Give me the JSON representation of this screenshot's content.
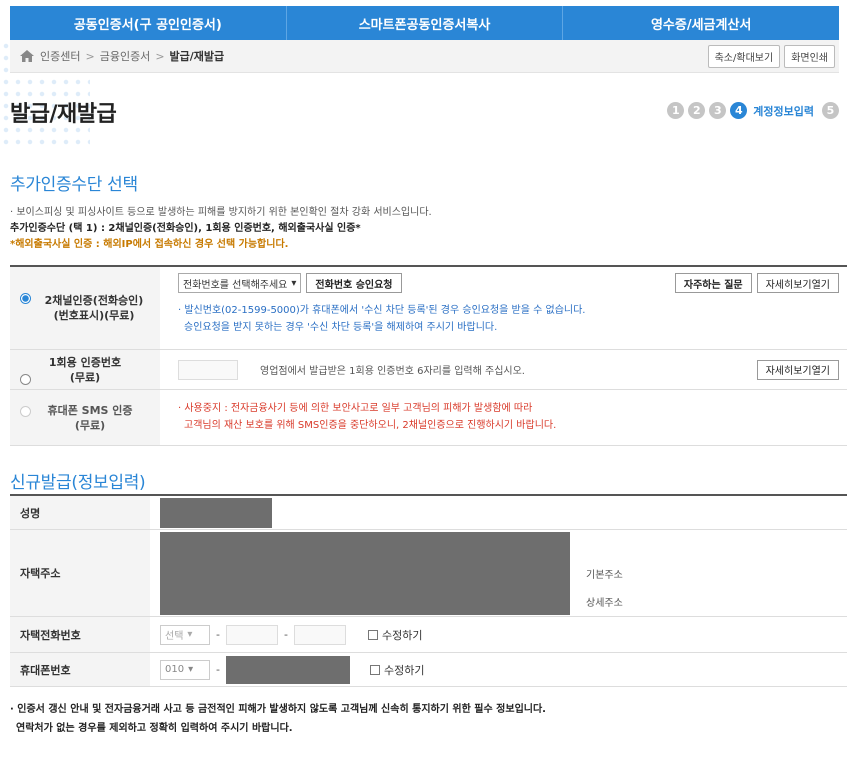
{
  "tabs": [
    "공동인증서(구 공인인증서)",
    "스마트폰공동인증서복사",
    "영수증/세금계산서"
  ],
  "breadcrumb": {
    "items": [
      "인증센터",
      "금융인증서",
      "발급/재발급"
    ],
    "separator": ">"
  },
  "toolbar": {
    "zoom_label": "축소/확대보기",
    "print_label": "화면인쇄"
  },
  "page_title": "발급/재발급",
  "steps": {
    "numbers": [
      "1",
      "2",
      "3",
      "4",
      "5"
    ],
    "active_label": "계정정보입력"
  },
  "section1": {
    "title": "추가인증수단 선택",
    "desc": "· 보이스피싱 및 피싱사이트 등으로 발생하는 피해를 방지하기 위한 본인확인 절차 강화 서비스입니다.",
    "choose": "추가인증수단 (택 1) : 2채널인증(전화승인), 1회용 인증번호, 해외출국사실 인증*",
    "overseas": "*해외출국사실 인증 : 해외IP에서 접속하신 경우 선택 가능합니다."
  },
  "auth": {
    "two_channel": {
      "label_line1": "2채널인증(전화승인)",
      "label_line2": "(번호표시)(무료)",
      "phone_select": "전화번호를 선택해주세요",
      "approve_btn": "전화번호 승인요청",
      "faq_btn": "자주하는 질문",
      "detail_btn": "자세히보기열기",
      "info1": "· 발신번호(02-1599-5000)가 휴대폰에서 '수신 차단 등록'된 경우 승인요청을 받을 수 없습니다.",
      "info2": "승인요청을 받지 못하는 경우 '수신 차단 등록'을 해제하여 주시기 바랍니다."
    },
    "otp": {
      "label_line1": "1회용 인증번호",
      "label_line2": "(무료)",
      "desc": "영업점에서 발급받은 1회용 인증번호 6자리를 입력해 주십시오.",
      "detail_btn": "자세히보기열기"
    },
    "sms": {
      "label_line1": "휴대폰 SMS 인증",
      "label_line2": "(무료)",
      "warn1": "· 사용중지 : 전자금융사기 등에 의한 보안사고로 일부 고객님의 피해가 발생함에 따라",
      "warn2": "고객님의 재산 보호를 위해 SMS인증을 중단하오니, 2채널인증으로 진행하시기 바랍니다."
    }
  },
  "section2": {
    "title": "신규발급(정보입력)"
  },
  "info": {
    "name_label": "성명",
    "address_label": "자택주소",
    "base_addr": "기본주소",
    "detail_addr": "상세주소",
    "home_phone_label": "자택전화번호",
    "home_phone_select": "선택",
    "mobile_label": "휴대폰번호",
    "mobile_select": "010",
    "edit_label": "수정하기",
    "dash": "-"
  },
  "footer_note": {
    "line1": "· 인증서 갱신 안내 및 전자금융거래 사고 등 금전적인 피해가 발생하지 않도록 고객님께 신속히 통지하기 위한 필수 정보입니다.",
    "line2": "연락처가 없는 경우를 제외하고 정확히 입력하여 주시기 바랍니다."
  },
  "colors": {
    "accent": "#2a86d6",
    "warning": "#d93a2a",
    "note_orange": "#c77a00"
  }
}
